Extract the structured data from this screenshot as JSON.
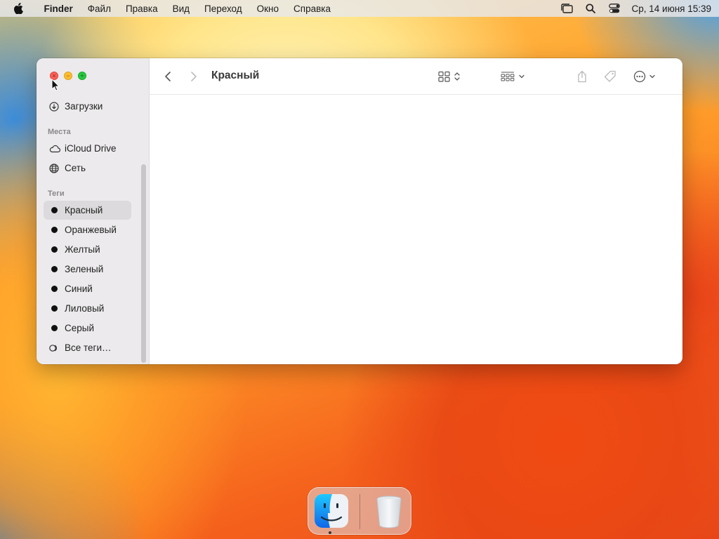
{
  "menubar": {
    "app_name": "Finder",
    "menus": [
      "Файл",
      "Правка",
      "Вид",
      "Переход",
      "Окно",
      "Справка"
    ],
    "clock": "Ср, 14 июня  15:39"
  },
  "window": {
    "title": "Красный",
    "sidebar": {
      "top_items": [
        {
          "label": "Загрузки",
          "icon": "downloads-icon"
        }
      ],
      "places_header": "Места",
      "places": [
        {
          "label": "iCloud Drive",
          "icon": "cloud-icon"
        },
        {
          "label": "Сеть",
          "icon": "globe-icon"
        }
      ],
      "tags_header": "Теги",
      "tags": [
        {
          "label": "Красный",
          "selected": true
        },
        {
          "label": "Оранжевый"
        },
        {
          "label": "Желтый"
        },
        {
          "label": "Зеленый"
        },
        {
          "label": "Синий"
        },
        {
          "label": "Лиловый"
        },
        {
          "label": "Серый"
        }
      ],
      "all_tags": "Все теги…"
    }
  },
  "dock": {
    "apps": [
      "finder-icon",
      "trash-icon"
    ]
  }
}
